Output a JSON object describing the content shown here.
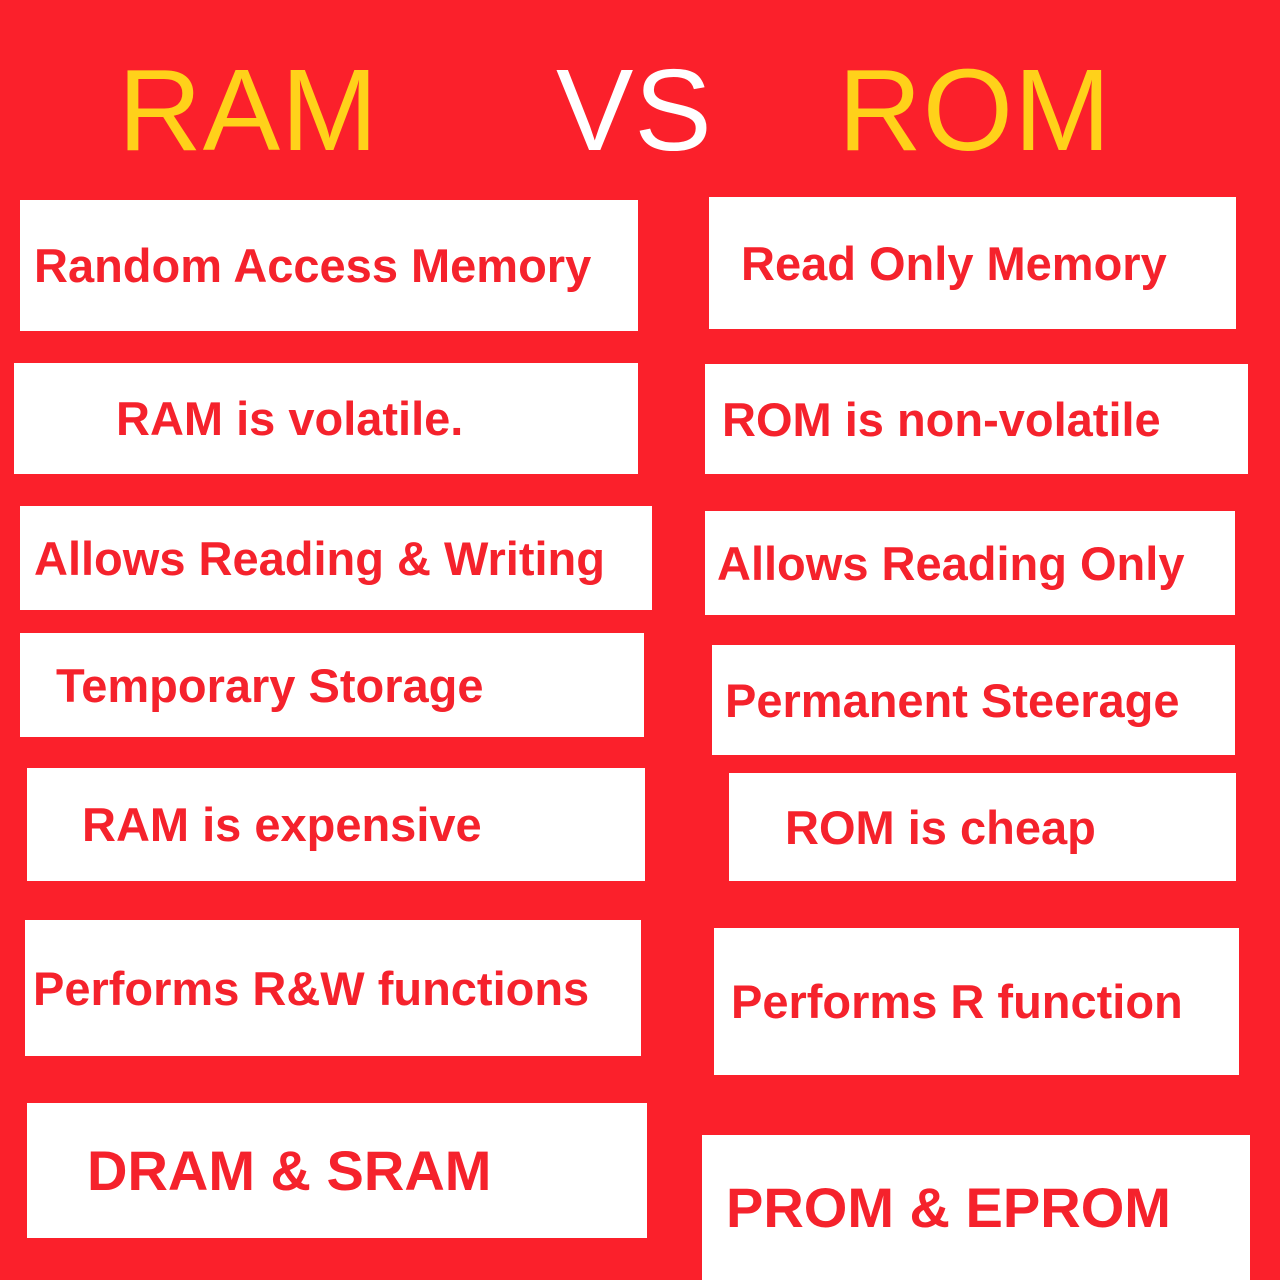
{
  "title": {
    "left": "RAM",
    "vs": "VS",
    "right": "ROM"
  },
  "colors": {
    "background_red": "#FB202B",
    "text_red": "#F5222C",
    "title_yellow": "#FFD11A",
    "title_white": "#FFFFFF",
    "card_white": "#FFFFFF"
  },
  "rows": [
    {
      "left": "Random Access Memory",
      "right": "Read Only Memory"
    },
    {
      "left": "RAM is volatile.",
      "right": "ROM is non-volatile"
    },
    {
      "left": "Allows Reading & Writing",
      "right": "Allows Reading Only"
    },
    {
      "left": "Temporary Storage",
      "right": "Permanent Steerage"
    },
    {
      "left": "RAM is expensive",
      "right": "ROM is cheap"
    },
    {
      "left": "Performs R&W functions",
      "right": "Performs R function"
    },
    {
      "left": "DRAM & SRAM",
      "right": "PROM & EPROM"
    }
  ]
}
